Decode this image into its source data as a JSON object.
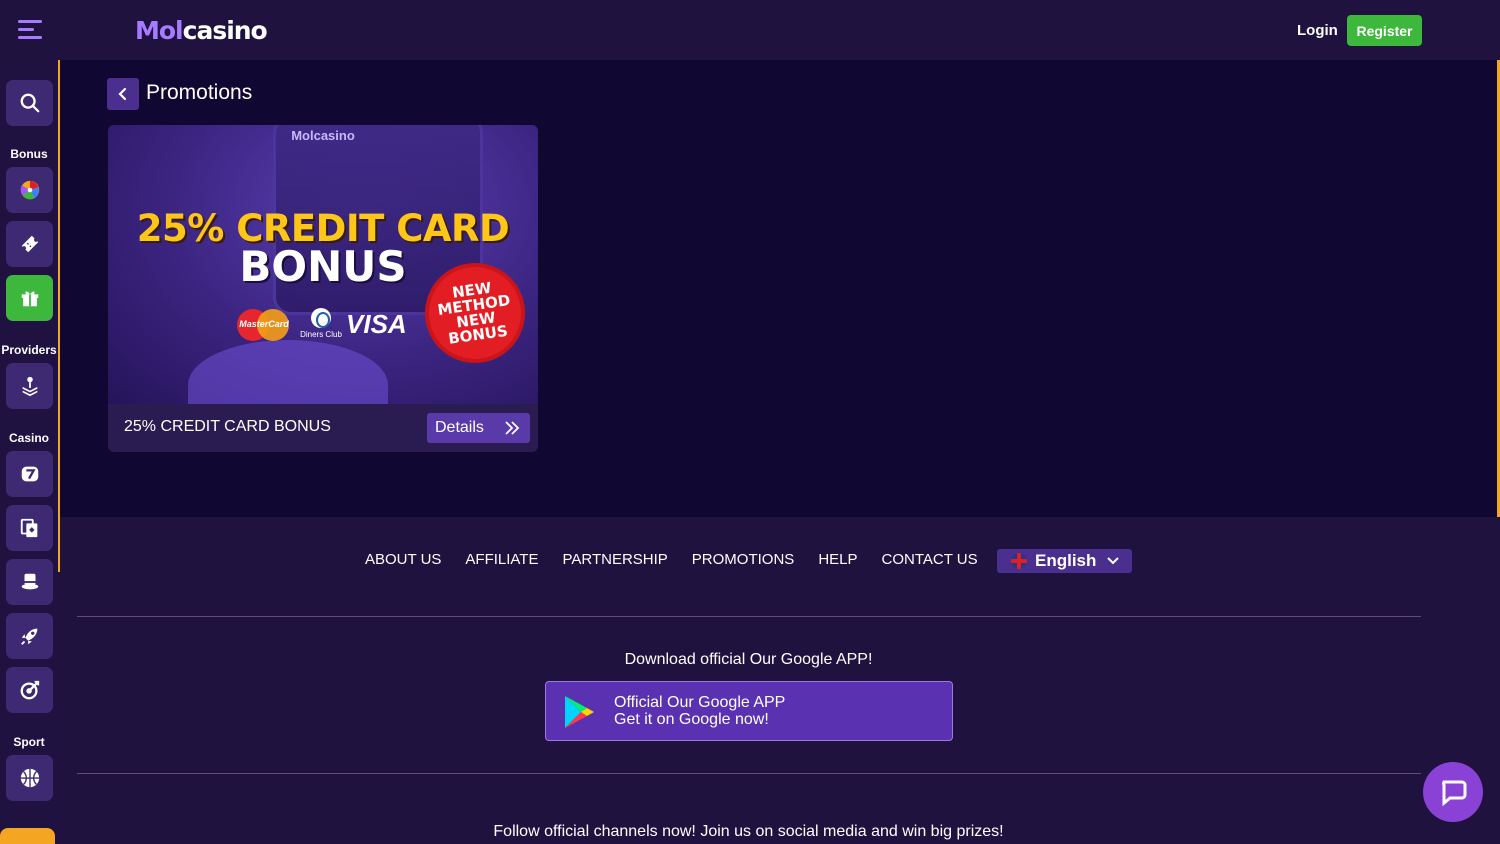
{
  "header": {
    "logo_mol": "Mol",
    "logo_casino": "casino",
    "login_label": "Login",
    "register_label": "Register",
    "brand_green": "#3db83d",
    "accent_purple": "#a77bff"
  },
  "sidebar": {
    "sections": {
      "bonus": "Bonus",
      "providers": "Providers",
      "casino": "Casino",
      "sport": "Sport"
    },
    "items": [
      {
        "icon": "search-icon"
      },
      {
        "icon": "wheel-icon"
      },
      {
        "icon": "ticket-icon"
      },
      {
        "icon": "gift-icon",
        "active": true
      },
      {
        "icon": "providers-icon"
      },
      {
        "icon": "slot-7-icon"
      },
      {
        "icon": "cards-icon"
      },
      {
        "icon": "magic-hat-icon"
      },
      {
        "icon": "rocket-icon"
      },
      {
        "icon": "target-icon"
      },
      {
        "icon": "basketball-icon"
      }
    ]
  },
  "main": {
    "page_title": "Promotions",
    "promotions": [
      {
        "banner_brand": "Molcasino",
        "banner_headline": "25% CREDIT CARD",
        "banner_headline2": "BONUS",
        "banner_badge": [
          "NEW",
          "METHOD",
          "NEW",
          "BONUS"
        ],
        "card_logos": [
          "MasterCard",
          "Diners Club",
          "VISA"
        ],
        "title": "25% CREDIT CARD BONUS",
        "details_label": "Details"
      }
    ]
  },
  "footer": {
    "nav": [
      "ABOUT US",
      "AFFILIATE",
      "PARTNERSHIP",
      "PROMOTIONS",
      "HELP",
      "CONTACT US"
    ],
    "language": "English",
    "download_title": "Download official Our Google APP!",
    "app_button_line1": "Official Our Google APP",
    "app_button_line2": "Get it on Google now!",
    "follow_text": "Follow official channels now! Join us on social media and win big prizes!"
  }
}
